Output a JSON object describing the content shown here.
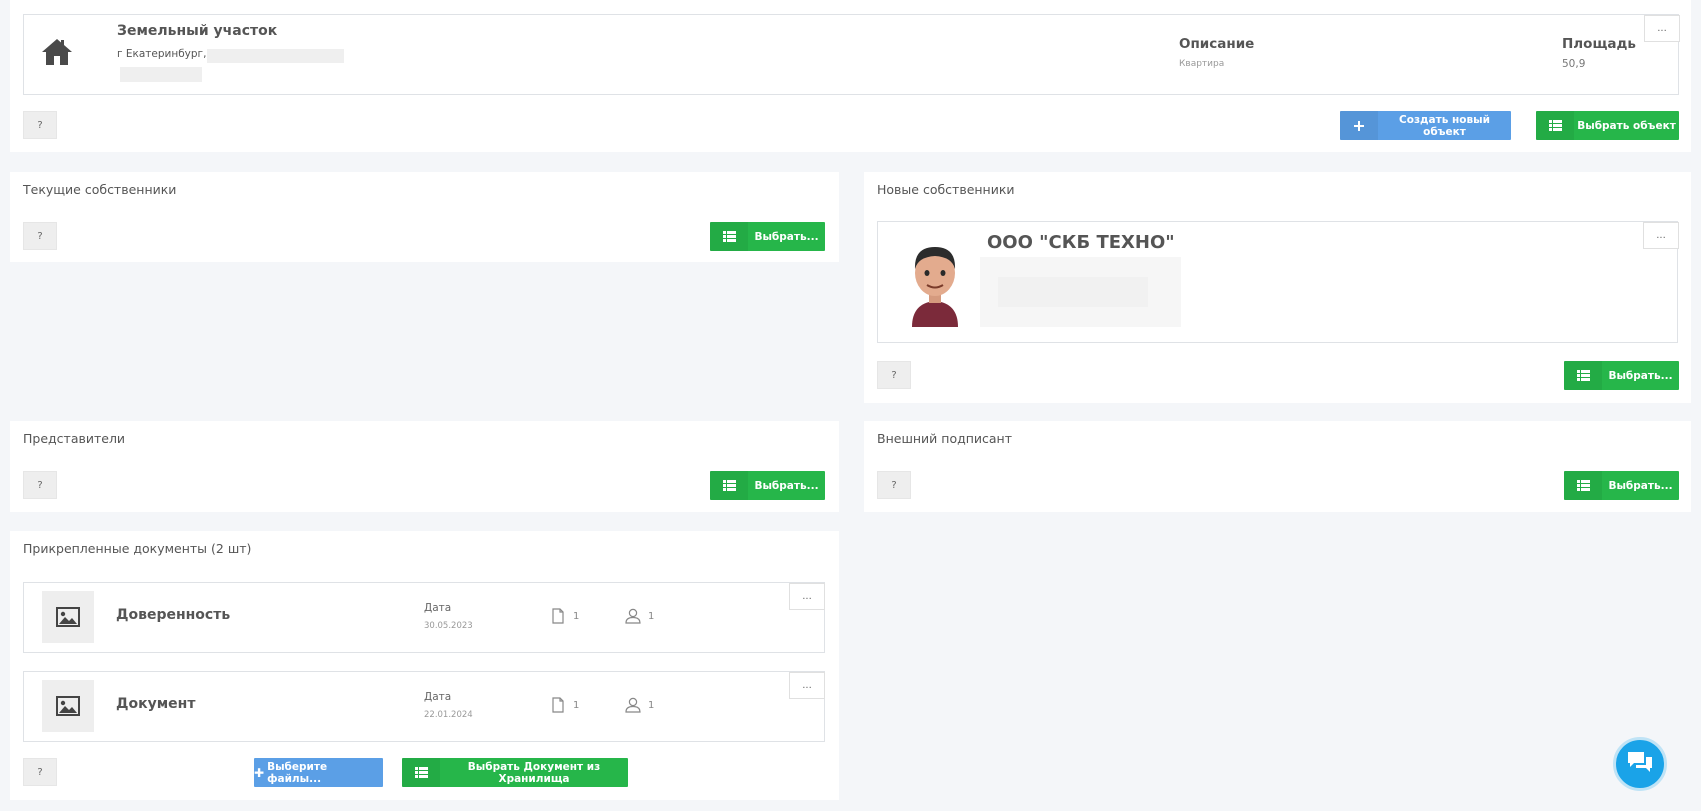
{
  "object": {
    "name": "Земельный участок",
    "address": "г Екатеринбург,",
    "description_label": "Описание",
    "description_value": "Квартира",
    "area_label": "Площадь",
    "area_value": "50,9",
    "more": "...",
    "help": "?",
    "create_label": "Создать новый объект",
    "select_label": "Выбрать объект"
  },
  "current_owners": {
    "title": "Текущие собственники",
    "help": "?",
    "select_label": "Выбрать..."
  },
  "new_owners": {
    "title": "Новые собственники",
    "owner_name": "ООО \"СКБ ТЕХНО\"",
    "more": "...",
    "help": "?",
    "select_label": "Выбрать..."
  },
  "representatives": {
    "title": "Представители",
    "help": "?",
    "select_label": "Выбрать..."
  },
  "external_signer": {
    "title": "Внешний подписант",
    "help": "?",
    "select_label": "Выбрать..."
  },
  "documents": {
    "title": "Прикрепленные документы (2 шт)",
    "items": [
      {
        "name": "Доверенность",
        "date_label": "Дата",
        "date": "30.05.2023",
        "files": "1",
        "people": "1",
        "more": "..."
      },
      {
        "name": "Документ",
        "date_label": "Дата",
        "date": "22.01.2024",
        "files": "1",
        "people": "1",
        "more": "..."
      }
    ],
    "help": "?",
    "choose_files_label": "Выберите файлы...",
    "choose_storage_label": "Выбрать Документ из Хранилища"
  },
  "icons": {
    "home": "home-icon",
    "plus": "plus-icon",
    "list": "list-icon",
    "image": "image-icon",
    "file": "file-icon",
    "user": "user-icon",
    "chat": "chat-icon",
    "avatar": "avatar-icon"
  },
  "colors": {
    "green": "#26b64a",
    "blue": "#5b9fe6",
    "chat": "#1aa3e8",
    "background": "#f4f6f9"
  }
}
